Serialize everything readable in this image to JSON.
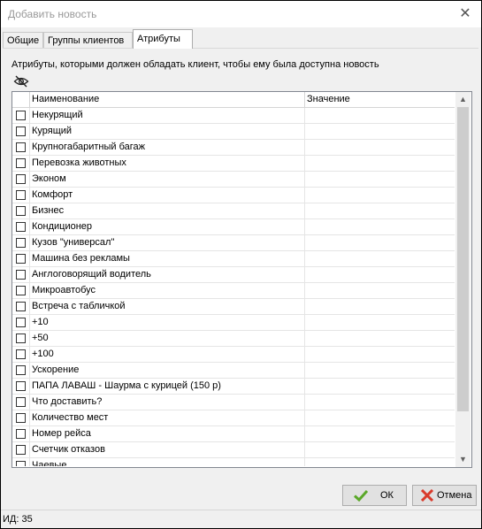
{
  "window": {
    "title": "Добавить новость",
    "close_icon": "close-icon"
  },
  "tabs": [
    {
      "label": "Общие",
      "active": false
    },
    {
      "label": "Группы клиентов",
      "active": false
    },
    {
      "label": "Атрибуты",
      "active": true
    }
  ],
  "attributes_tab": {
    "description": "Атрибуты, которыми должен обладать клиент, чтобы ему была доступна новость",
    "toggle_icon": "eye-off-icon",
    "columns": {
      "name": "Наименование",
      "value": "Значение"
    },
    "rows": [
      {
        "name": "Некурящий",
        "value": "",
        "checked": false
      },
      {
        "name": "Курящий",
        "value": "",
        "checked": false
      },
      {
        "name": "Крупногабаритный багаж",
        "value": "",
        "checked": false
      },
      {
        "name": "Перевозка животных",
        "value": "",
        "checked": false
      },
      {
        "name": "Эконом",
        "value": "",
        "checked": false
      },
      {
        "name": "Комфорт",
        "value": "",
        "checked": false
      },
      {
        "name": "Бизнес",
        "value": "",
        "checked": false
      },
      {
        "name": "Кондиционер",
        "value": "",
        "checked": false
      },
      {
        "name": "Кузов \"универсал\"",
        "value": "",
        "checked": false
      },
      {
        "name": "Машина без рекламы",
        "value": "",
        "checked": false
      },
      {
        "name": "Англоговорящий водитель",
        "value": "",
        "checked": false
      },
      {
        "name": "Микроавтобус",
        "value": "",
        "checked": false
      },
      {
        "name": "Встреча с табличкой",
        "value": "",
        "checked": false
      },
      {
        "name": "+10",
        "value": "",
        "checked": false
      },
      {
        "name": "+50",
        "value": "",
        "checked": false
      },
      {
        "name": "+100",
        "value": "",
        "checked": false
      },
      {
        "name": "Ускорение",
        "value": "",
        "checked": false
      },
      {
        "name": "ПАПА ЛАВАШ - Шаурма с курицей (150 р)",
        "value": "",
        "checked": false
      },
      {
        "name": "Что доставить?",
        "value": "",
        "checked": false
      },
      {
        "name": "Количество мест",
        "value": "",
        "checked": false
      },
      {
        "name": "Номер рейса",
        "value": "",
        "checked": false
      },
      {
        "name": "Счетчик отказов",
        "value": "",
        "checked": false
      },
      {
        "name": "Чаевые",
        "value": "",
        "checked": false
      }
    ]
  },
  "buttons": {
    "ok_label": "ОК",
    "ok_icon": "checkmark-icon",
    "ok_color": "#5ba829",
    "cancel_label": "Отмена",
    "cancel_icon": "cross-icon",
    "cancel_color": "#d93a2b"
  },
  "statusbar": {
    "text": "ИД: 35"
  }
}
